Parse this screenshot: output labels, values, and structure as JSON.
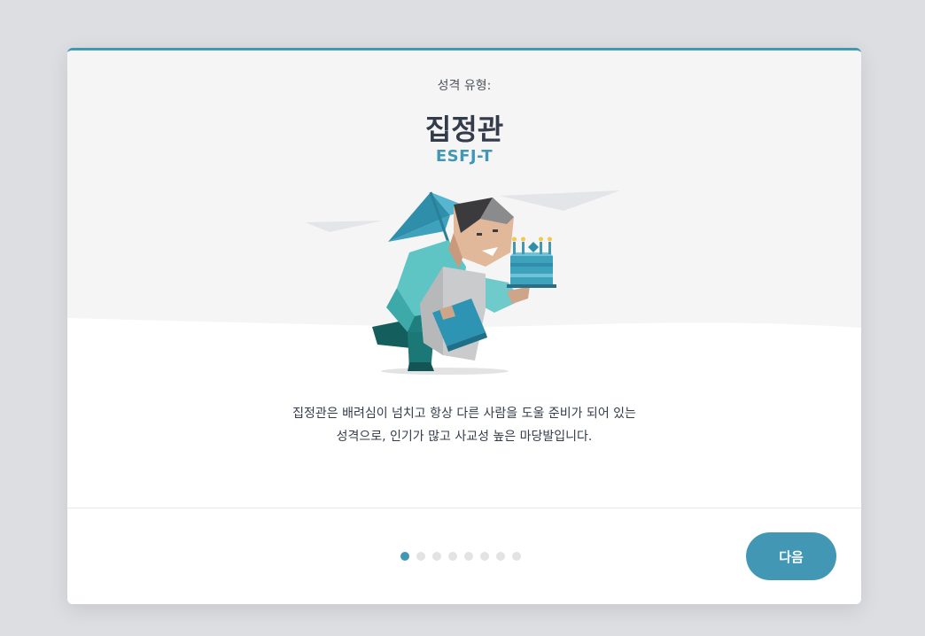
{
  "header": {
    "subtitle": "성격 유형:",
    "type_name": "집정관",
    "type_code": "ESFJ-T"
  },
  "description": {
    "line1": "집정관은 배려심이 넘치고 항상 다른 사람을 도울 준비가 되어 있는",
    "line2": "성격으로, 인기가 많고 사교성 높은 마당발입니다."
  },
  "pagination": {
    "total": 8,
    "current": 1
  },
  "footer": {
    "next_label": "다음"
  },
  "colors": {
    "accent": "#4298b4",
    "heading": "#343c4b",
    "backdrop": "#dddee2",
    "hero_background": "#f5f5f5"
  },
  "illustration": {
    "icon": "person-with-umbrella-and-birthday-cake-illustration"
  }
}
